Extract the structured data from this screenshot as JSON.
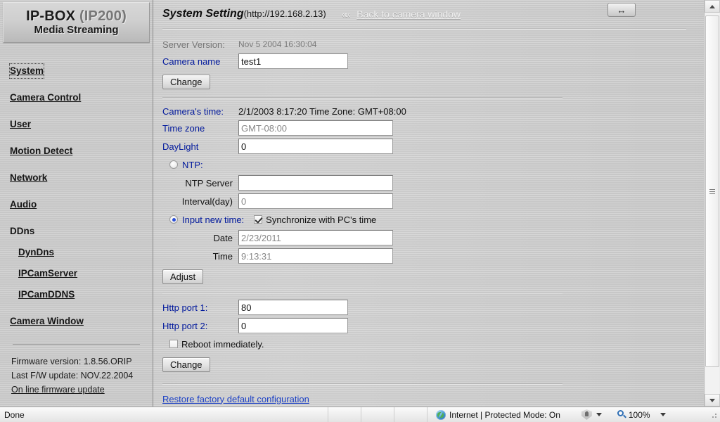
{
  "brand": {
    "line1_main": "IP-BOX",
    "line1_model": "(IP200)",
    "line2": "Media Streaming"
  },
  "sidebar": {
    "items": [
      {
        "label": "System",
        "selected": true,
        "link": true,
        "sub": false
      },
      {
        "label": "Camera Control",
        "selected": false,
        "link": true,
        "sub": false
      },
      {
        "label": "User",
        "selected": false,
        "link": true,
        "sub": false
      },
      {
        "label": "Motion Detect",
        "selected": false,
        "link": true,
        "sub": false
      },
      {
        "label": "Network",
        "selected": false,
        "link": true,
        "sub": false
      },
      {
        "label": "Audio",
        "selected": false,
        "link": true,
        "sub": false
      },
      {
        "label": "DDns",
        "selected": false,
        "link": false,
        "sub": false
      },
      {
        "label": "DynDns",
        "selected": false,
        "link": true,
        "sub": true
      },
      {
        "label": "IPCamServer",
        "selected": false,
        "link": true,
        "sub": true
      },
      {
        "label": "IPCamDDNS",
        "selected": false,
        "link": true,
        "sub": true
      },
      {
        "label": "Camera Window",
        "selected": false,
        "link": true,
        "sub": false
      }
    ],
    "firmware_version": "Firmware version: 1.8.56.ORIP",
    "last_update": "Last F/W update: NOV.22.2004",
    "online_update_link": "On line firmware update"
  },
  "header": {
    "title": "System Setting",
    "url": "(http://192.168.2.13)",
    "chevrons": "««",
    "back_link": "Back to camera window",
    "maximize_icon": "↔"
  },
  "form": {
    "server_version_label": "Server Version:",
    "server_version_value": "Nov  5 2004 16:30:04",
    "camera_name_label": "Camera name",
    "camera_name_value": "test1",
    "camera_name_change_button": "Change",
    "camera_time_label": "Camera's time:",
    "camera_time_value": "2/1/2003 8:17:20 Time Zone: GMT+08:00",
    "time_zone_label": "Time zone",
    "time_zone_value": "GMT-08:00",
    "daylight_label": "DayLight",
    "daylight_value": "0",
    "ntp_radio_label": "NTP:",
    "ntp_selected": false,
    "ntp_server_label": "NTP Server",
    "ntp_server_value": "",
    "interval_label": "Interval(day)",
    "interval_value": "0",
    "input_new_time_label": "Input new time:",
    "input_new_time_selected": true,
    "sync_checkbox_label": "Synchronize with PC's time",
    "sync_checked": true,
    "date_label": "Date",
    "date_value": "2/23/2011",
    "time_label": "Time",
    "time_value": "9:13:31",
    "adjust_button": "Adjust",
    "http_port1_label": "Http port 1:",
    "http_port1_value": "80",
    "http_port2_label": "Http port 2:",
    "http_port2_value": "0",
    "reboot_checkbox_label": "Reboot immediately.",
    "reboot_checked": false,
    "port_change_button": "Change",
    "restore_link": "Restore factory default configuration"
  },
  "statusbar": {
    "status_text": "Done",
    "zone_label": "Internet | Protected Mode: On",
    "zoom_level": "100%"
  },
  "colors": {
    "label_blue": "#00189c",
    "link_blue": "#1d41c4",
    "page_bg": "#c9c9c9"
  }
}
